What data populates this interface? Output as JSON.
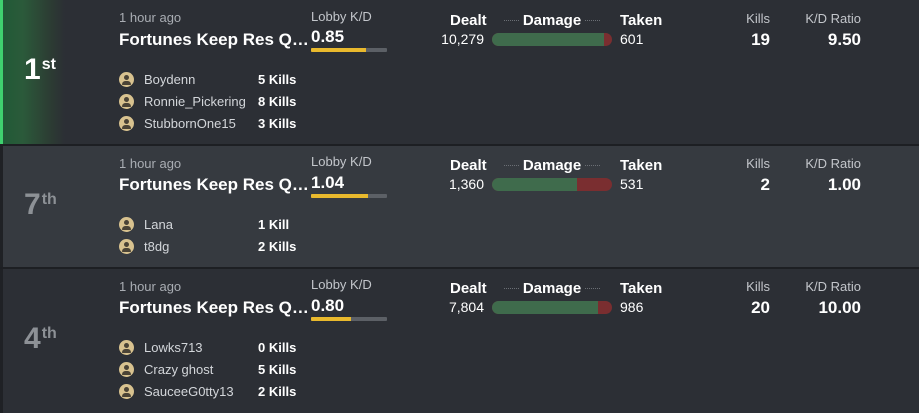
{
  "colors": {
    "win_accent": "#3fd16f",
    "kd_bar": "#e9b92d",
    "damage_dealt": "#3f6b4c",
    "damage_taken": "#7a2e30"
  },
  "labels": {
    "lobby_kd": "Lobby K/D",
    "dealt": "Dealt",
    "damage": "Damage",
    "taken": "Taken",
    "kills": "Kills",
    "kd_ratio": "K/D Ratio"
  },
  "matches": [
    {
      "place": "1",
      "place_suffix": "st",
      "time": "1 hour ago",
      "title": "Fortunes Keep Res Quads",
      "lobby_kd": "0.85",
      "lobby_kd_fill": 0.72,
      "dealt": "10,279",
      "taken": "601",
      "damage_dealt_fraction": 0.93,
      "kills": "19",
      "kd_ratio": "9.50",
      "players": [
        {
          "name": "Boydenn",
          "kills": "5 Kills"
        },
        {
          "name": "Ronnie_Pickering",
          "kills": "8 Kills"
        },
        {
          "name": "StubbornOne15",
          "kills": "3 Kills"
        }
      ]
    },
    {
      "place": "7",
      "place_suffix": "th",
      "time": "1 hour ago",
      "title": "Fortunes Keep Res Quads",
      "lobby_kd": "1.04",
      "lobby_kd_fill": 0.75,
      "dealt": "1,360",
      "taken": "531",
      "damage_dealt_fraction": 0.71,
      "kills": "2",
      "kd_ratio": "1.00",
      "players": [
        {
          "name": "Lana",
          "kills": "1 Kill"
        },
        {
          "name": "t8dg",
          "kills": "2 Kills"
        }
      ]
    },
    {
      "place": "4",
      "place_suffix": "th",
      "time": "1 hour ago",
      "title": "Fortunes Keep Res Quads",
      "lobby_kd": "0.80",
      "lobby_kd_fill": 0.53,
      "dealt": "7,804",
      "taken": "986",
      "damage_dealt_fraction": 0.88,
      "kills": "20",
      "kd_ratio": "10.00",
      "players": [
        {
          "name": "Lowks713",
          "kills": "0 Kills"
        },
        {
          "name": "Crazy ghost",
          "kills": "5 Kills"
        },
        {
          "name": "SauceeG0tty13",
          "kills": "2 Kills"
        }
      ]
    }
  ]
}
